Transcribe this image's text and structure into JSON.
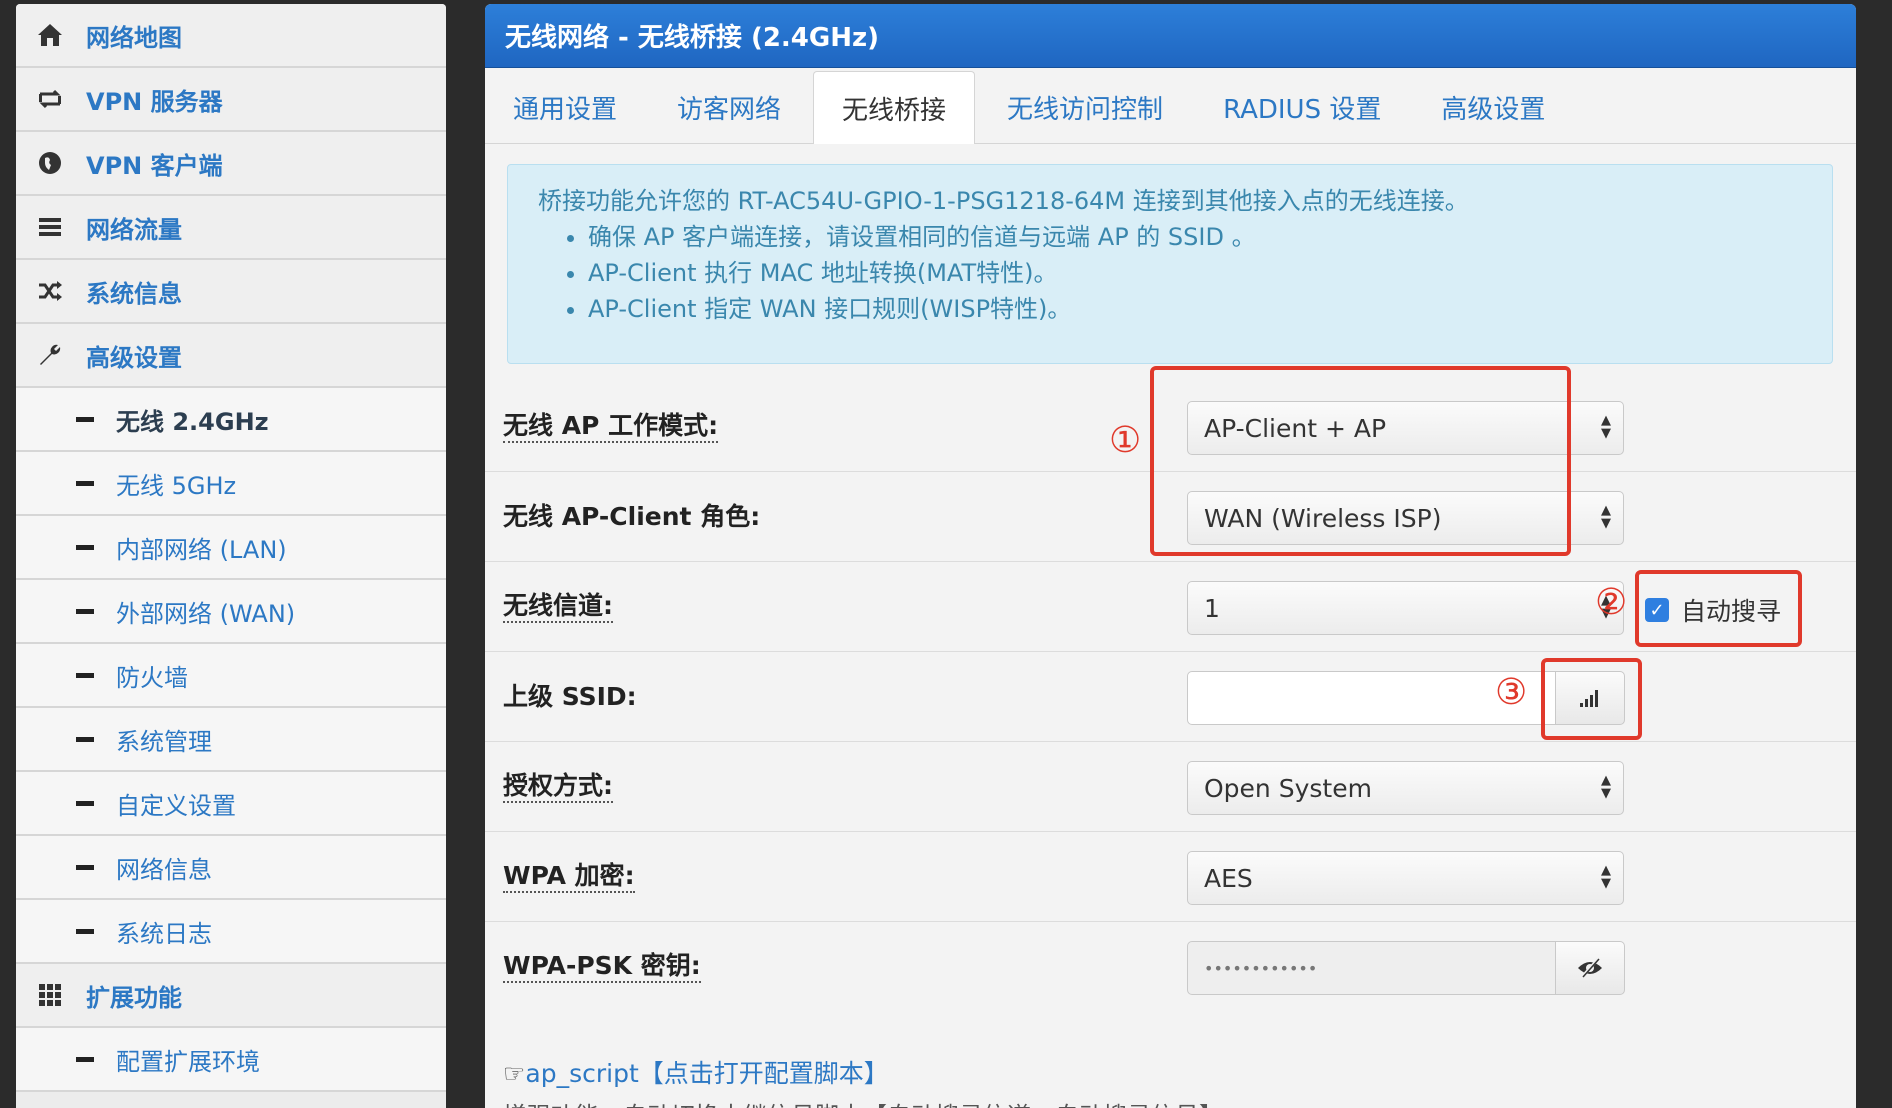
{
  "sidebar": {
    "items": [
      {
        "icon": "home-icon",
        "label": "网络地图"
      },
      {
        "icon": "vpn-server-icon",
        "label": "VPN 服务器"
      },
      {
        "icon": "globe-icon",
        "label": "VPN 客户端"
      },
      {
        "icon": "traffic-icon",
        "label": "网络流量"
      },
      {
        "icon": "shuffle-icon",
        "label": "系统信息"
      },
      {
        "icon": "wrench-icon",
        "label": "高级设置"
      }
    ],
    "advanced_sub": [
      {
        "label": "无线 2.4GHz",
        "active": true
      },
      {
        "label": "无线 5GHz"
      },
      {
        "label": "内部网络 (LAN)"
      },
      {
        "label": "外部网络 (WAN)"
      },
      {
        "label": "防火墙"
      },
      {
        "label": "系统管理"
      },
      {
        "label": "自定义设置"
      },
      {
        "label": "网络信息"
      },
      {
        "label": "系统日志"
      }
    ],
    "ext": {
      "icon": "grid-icon",
      "label": "扩展功能"
    },
    "ext_sub": [
      {
        "label": "配置扩展环境"
      }
    ]
  },
  "main": {
    "title": "无线网络 - 无线桥接 (2.4GHz)",
    "tabs": [
      {
        "label": "通用设置"
      },
      {
        "label": "访客网络"
      },
      {
        "label": "无线桥接",
        "active": true
      },
      {
        "label": "无线访问控制"
      },
      {
        "label": "RADIUS 设置"
      },
      {
        "label": "高级设置"
      }
    ],
    "info": {
      "intro": "桥接功能允许您的 RT-AC54U-GPIO-1-PSG1218-64M 连接到其他接入点的无线连接。",
      "bullets": [
        "确保 AP 客户端连接，请设置相同的信道与远端 AP 的 SSID 。",
        "AP-Client 执行 MAC 地址转换(MAT特性)。",
        "AP-Client 指定 WAN 接口规则(WISP特性)。"
      ]
    },
    "form": {
      "ap_mode_label": "无线 AP 工作模式:",
      "ap_mode_value": "AP-Client + AP",
      "role_label": "无线 AP-Client 角色:",
      "role_value": "WAN (Wireless ISP)",
      "channel_label": "无线信道:",
      "channel_value": "1",
      "auto_search_label": "自动搜寻",
      "auto_search_checked": true,
      "ssid_label": "上级 SSID:",
      "ssid_value": "",
      "auth_label": "授权方式:",
      "auth_value": "Open System",
      "wpa_label": "WPA 加密:",
      "wpa_value": "AES",
      "psk_label": "WPA-PSK 密钥:",
      "psk_value": "••••••••••••"
    },
    "annotations": [
      "①",
      "②",
      "③"
    ],
    "script_link": "ap_script【点击打开配置脚本】",
    "script_desc": "增强功能：自动切换中继信号脚本【自动搜寻信道，自动搜寻信号】"
  },
  "colors": {
    "title_bar": "#2d7fd9",
    "link": "#2c78c4",
    "annotation_red": "#e0392b",
    "info_bg": "#d9eef7"
  }
}
